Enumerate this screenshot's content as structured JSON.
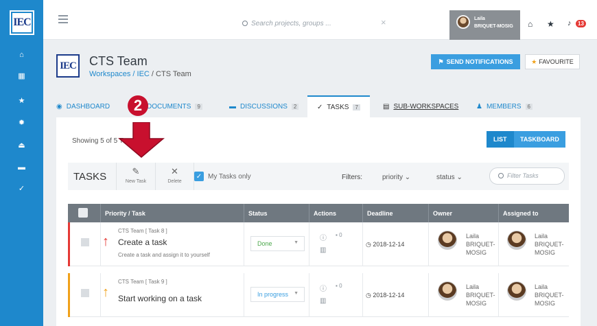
{
  "rail": {
    "logo_text": "IEC"
  },
  "topbar": {
    "search_placeholder": "Search projects, groups ...",
    "clear": "×",
    "user_first": "Laila",
    "user_last": "BRIQUET-MOSIG",
    "notification_count": "13"
  },
  "header": {
    "logo_text": "IEC",
    "title": "CTS Team",
    "breadcrumb": {
      "workspaces": "Workspaces",
      "sep1": "/",
      "iec": "IEC",
      "sep2": "/",
      "current": "CTS Team"
    },
    "send_notifications": "SEND NOTIFICATIONS",
    "favourite": "FAVOURITE"
  },
  "tabs": [
    {
      "label": "DASHBOARD",
      "count": ""
    },
    {
      "label": "DOCUMENTS",
      "count": "9"
    },
    {
      "label": "DISCUSSIONS",
      "count": "2"
    },
    {
      "label": "TASKS",
      "count": "7"
    },
    {
      "label": "SUB-WORKSPACES",
      "count": ""
    },
    {
      "label": "MEMBERS",
      "count": "6"
    }
  ],
  "card": {
    "showing": "Showing 5 of 5 T",
    "view_list": "LIST",
    "view_board": "TASKBOARD"
  },
  "toolbar": {
    "title": "TASKS",
    "new_task": "New Task",
    "delete": "Delete",
    "my_tasks": "My Tasks only",
    "filters_label": "Filters:",
    "filter_priority": "priority",
    "filter_status": "status",
    "filter_placeholder": "Filter Tasks"
  },
  "table": {
    "columns": [
      "Priority / Task",
      "Status",
      "Actions",
      "Deadline",
      "Owner",
      "Assigned to"
    ],
    "rows": [
      {
        "meta": "CTS Team [ Task 8 ]",
        "title": "Create a task",
        "desc": "Create a task and assign it to yourself",
        "status": "Done",
        "comments": "0",
        "deadline": "2018-12-14",
        "owner_first": "Laila",
        "owner_l1": "BRIQUET-",
        "owner_l2": "MOSIG",
        "assignee_first": "Laila",
        "assignee_l1": "BRIQUET-",
        "assignee_l2": "MOSIG",
        "bar_color": "#e53935",
        "arrow_color": "#e53935"
      },
      {
        "meta": "CTS Team [ Task 9 ]",
        "title": "Start working on a task",
        "desc": "",
        "status": "In progress",
        "comments": "0",
        "deadline": "2018-12-14",
        "owner_first": "Laila",
        "owner_l1": "BRIQUET-",
        "owner_l2": "MOSIG",
        "assignee_first": "Laila",
        "assignee_l1": "BRIQUET-",
        "assignee_l2": "MOSIG",
        "bar_color": "#f0a11a",
        "arrow_color": "#f0a11a"
      }
    ]
  },
  "annotation": {
    "step": "2"
  }
}
